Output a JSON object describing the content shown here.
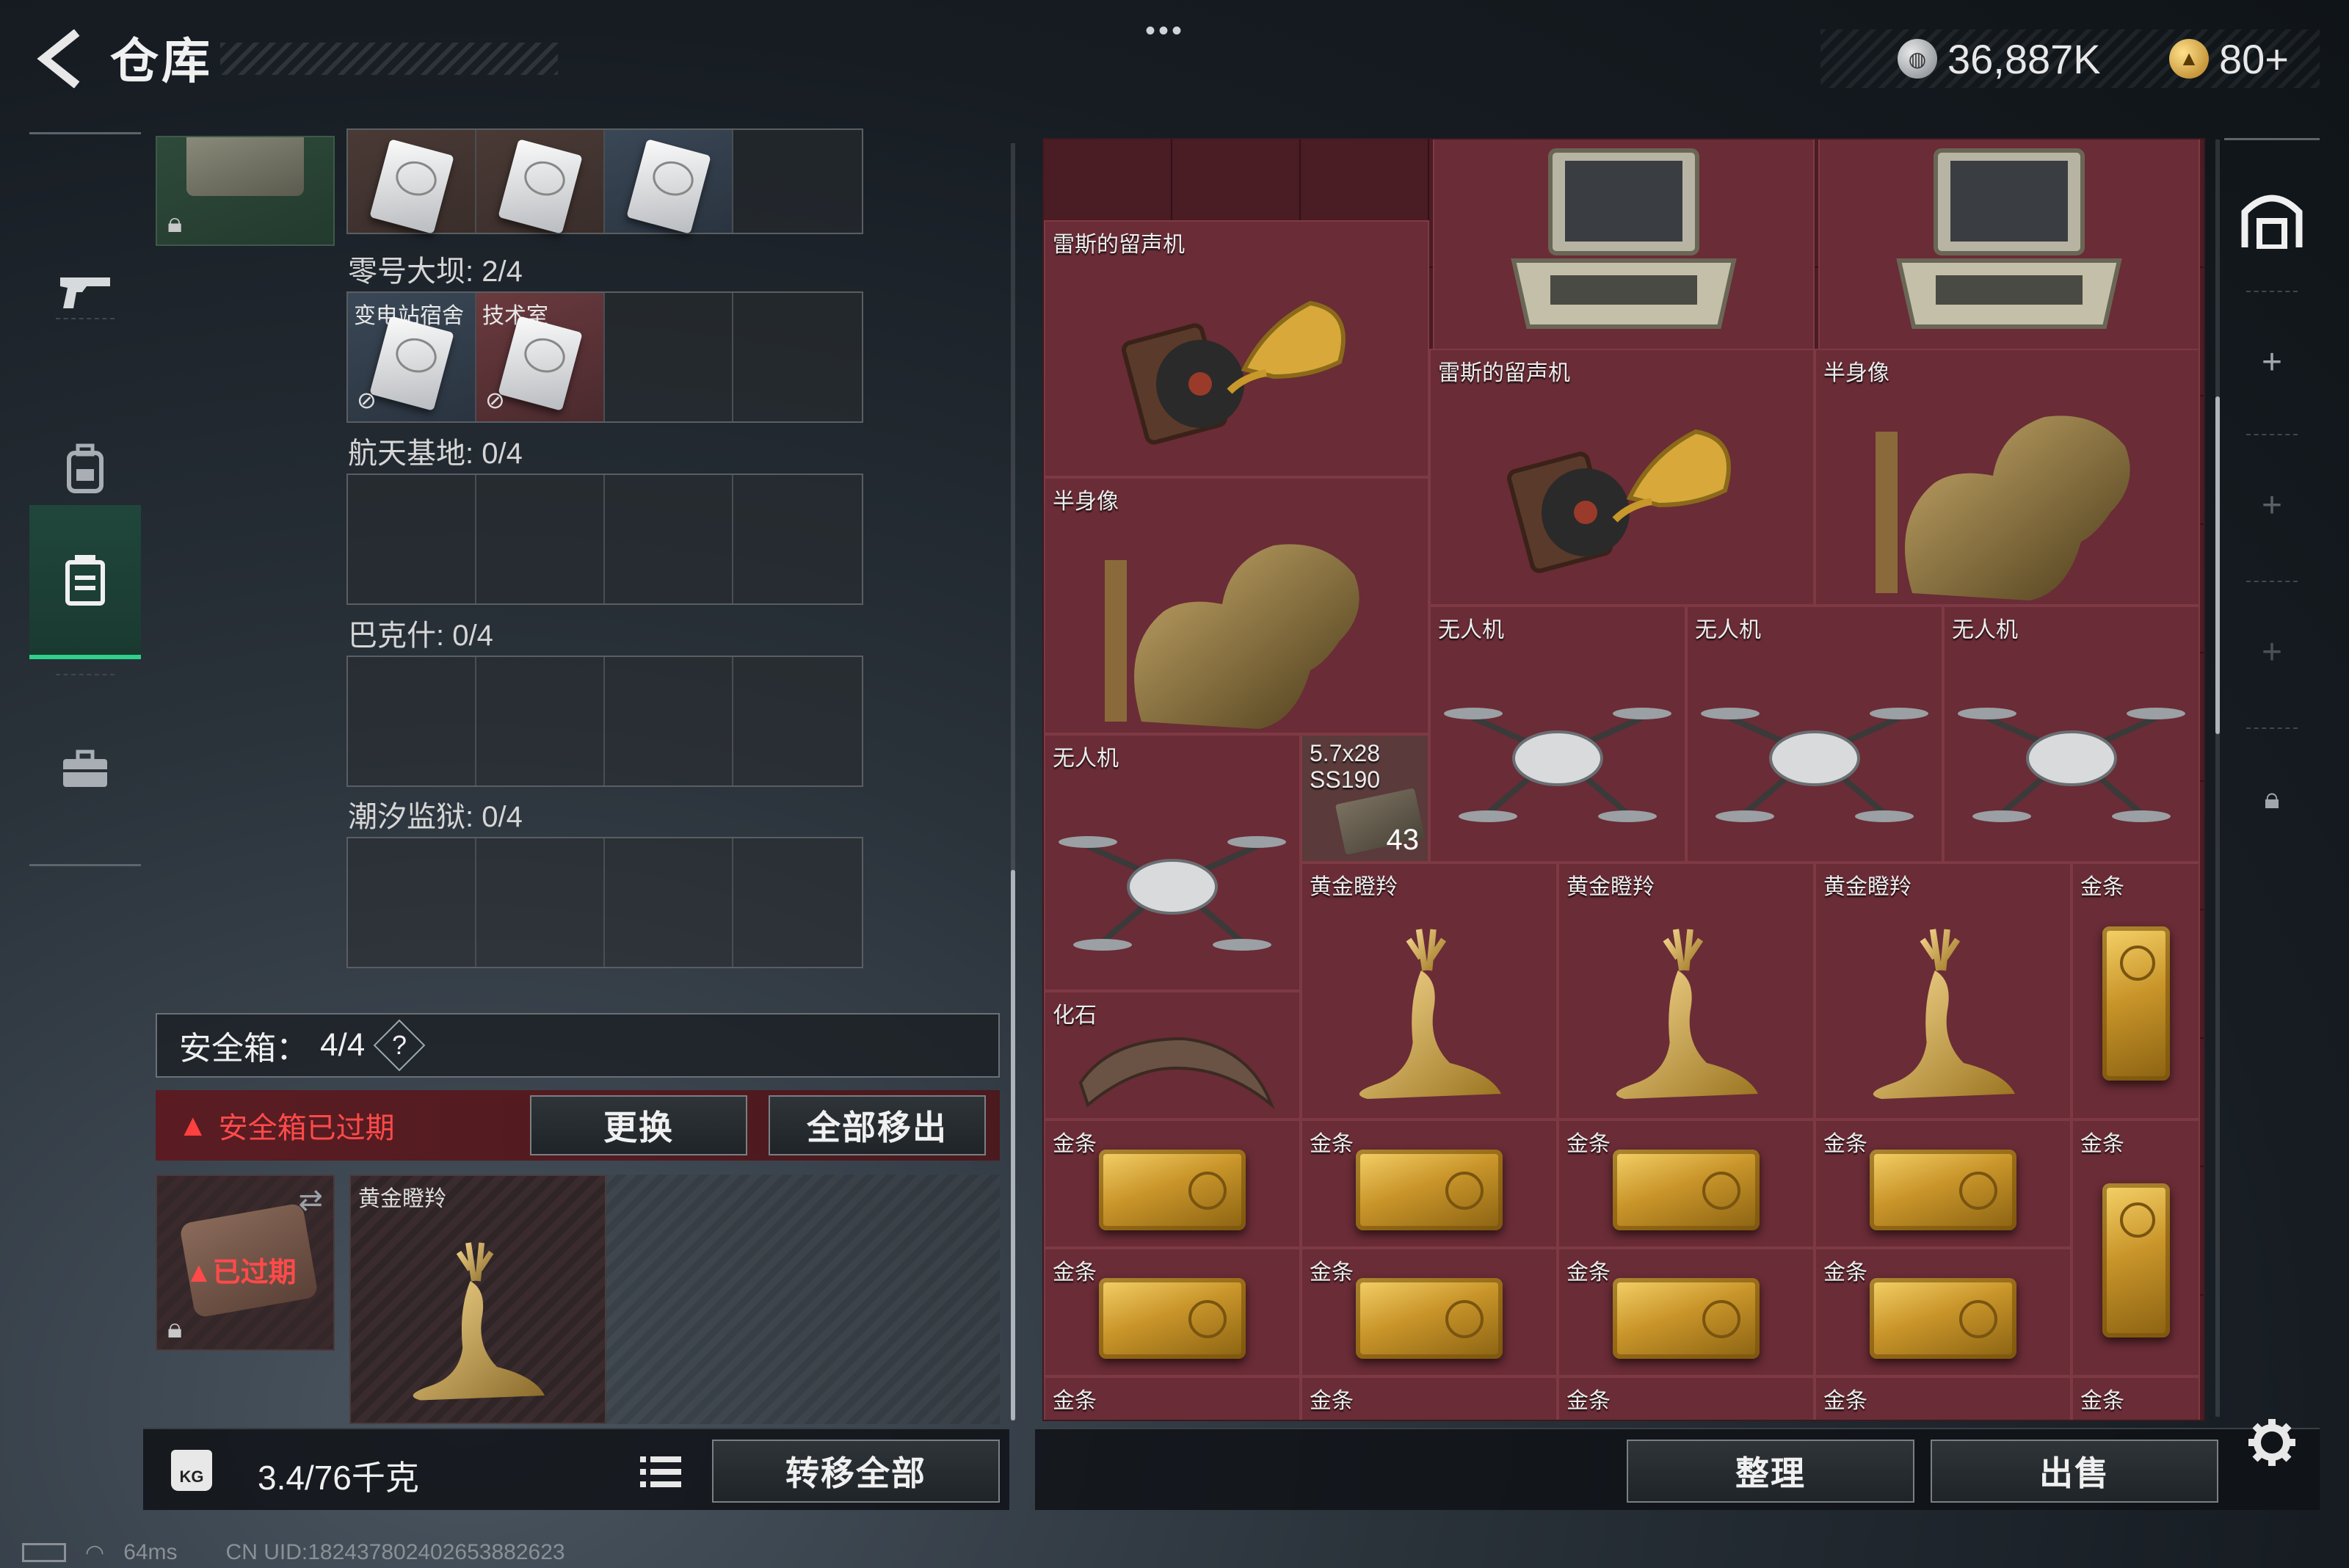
{
  "header": {
    "title": "仓库",
    "more": "•••",
    "currency": [
      {
        "icon": "silver-coin-icon",
        "value": "36,887K"
      },
      {
        "icon": "gold-coin-icon",
        "value": "80+"
      }
    ]
  },
  "leftnav": {
    "items": [
      {
        "icon": "gun-icon"
      },
      {
        "icon": "backpack-icon"
      },
      {
        "icon": "container-icon",
        "active": true
      },
      {
        "icon": "toolbox-icon"
      }
    ]
  },
  "stash": {
    "zones": [
      {
        "label": "零号大坝: 2/4",
        "slots": [
          {
            "label": "变电站宿舍"
          },
          {
            "label": "技术室"
          }
        ]
      },
      {
        "label": "航天基地: 0/4"
      },
      {
        "label": "巴克什: 0/4"
      },
      {
        "label": "潮汐监狱: 0/4"
      }
    ],
    "safebox": {
      "label": "安全箱：",
      "count": "4/4",
      "help": "?",
      "warning": "安全箱已过期",
      "replace_btn": "更换",
      "remove_all_btn": "全部移出",
      "expired_label": "已过期",
      "item_name": "黄金瞪羚"
    },
    "weight_icon_text": "KG",
    "weight": "3.4/76千克",
    "transfer_all_btn": "转移全部"
  },
  "inventory": {
    "items": {
      "gramophone1": "雷斯的留声机",
      "gramophone2": "雷斯的留声机",
      "bust1": "半身像",
      "bust2": "半身像",
      "drone1": "无人机",
      "drone2": "无人机",
      "drone3": "无人机",
      "drone4": "无人机",
      "ammo": "5.7x28 SS190",
      "ammo_qty": "43",
      "deer1": "黄金瞪羚",
      "deer2": "黄金瞪羚",
      "deer3": "黄金瞪羚",
      "fossil": "化石",
      "gold": "金条"
    },
    "sort_btn": "整理",
    "sell_btn": "出售"
  },
  "status": {
    "ping": "64ms",
    "uid": "CN UID:18243780240265388262​3"
  }
}
